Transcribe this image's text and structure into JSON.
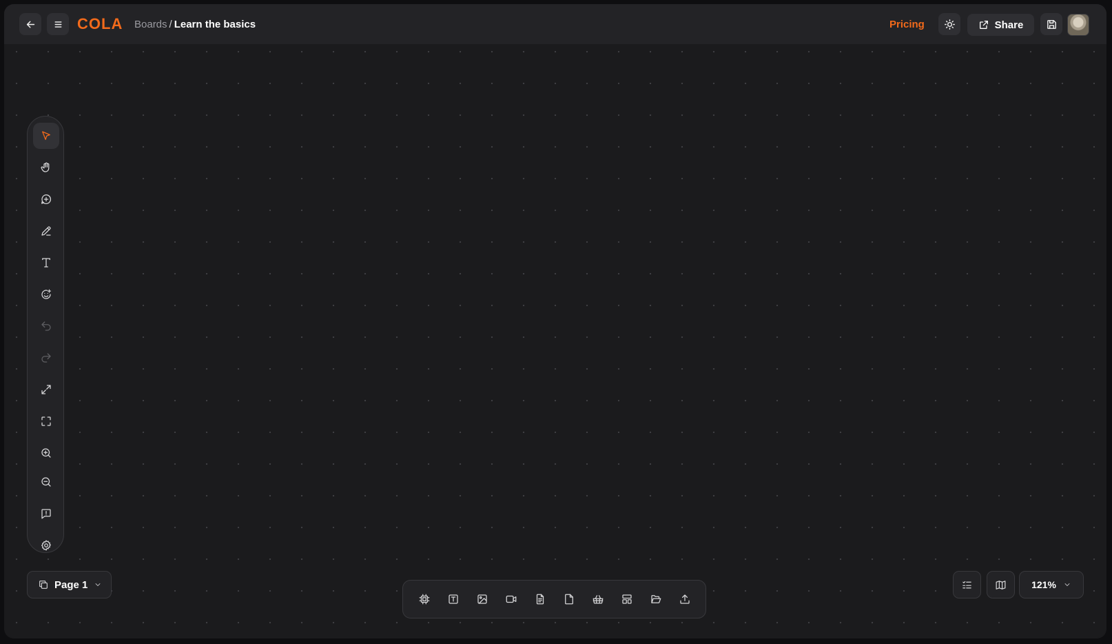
{
  "header": {
    "logo": "COLA",
    "breadcrumb_parent": "Boards",
    "breadcrumb_separator": "/",
    "breadcrumb_current": "Learn the basics",
    "pricing_label": "Pricing",
    "share_label": "Share"
  },
  "left_toolbar": {
    "tools": [
      {
        "name": "select-tool",
        "icon": "cursor-icon",
        "state": "active"
      },
      {
        "name": "hand-tool",
        "icon": "hand-icon",
        "state": "normal"
      },
      {
        "name": "add-tool",
        "icon": "plus-circle-icon",
        "state": "normal"
      },
      {
        "name": "pen-tool",
        "icon": "pencil-icon",
        "state": "normal"
      },
      {
        "name": "text-tool",
        "icon": "text-icon",
        "state": "normal"
      },
      {
        "name": "sticker-tool",
        "icon": "smiley-plus-icon",
        "state": "normal"
      },
      {
        "name": "undo-button",
        "icon": "undo-icon",
        "state": "disabled"
      },
      {
        "name": "redo-button",
        "icon": "redo-icon",
        "state": "disabled"
      },
      {
        "name": "expand-button",
        "icon": "expand-icon",
        "state": "normal"
      },
      {
        "name": "fit-screen-button",
        "icon": "focus-frame-icon",
        "state": "normal"
      },
      {
        "name": "zoom-in-button",
        "icon": "zoom-in-icon",
        "state": "normal"
      },
      {
        "name": "zoom-out-button",
        "icon": "zoom-out-icon",
        "state": "normal"
      },
      {
        "name": "feedback-button",
        "icon": "message-alert-icon",
        "state": "normal"
      },
      {
        "name": "settings-button",
        "icon": "gear-icon",
        "state": "normal"
      }
    ]
  },
  "page_selector": {
    "label": "Page 1"
  },
  "bottom_toolbar": {
    "items": [
      {
        "name": "frame-tool",
        "icon": "frame-icon"
      },
      {
        "name": "text-box-tool",
        "icon": "text-box-icon"
      },
      {
        "name": "image-tool",
        "icon": "image-icon"
      },
      {
        "name": "video-tool",
        "icon": "video-icon"
      },
      {
        "name": "document-tool",
        "icon": "document-icon"
      },
      {
        "name": "note-tool",
        "icon": "note-icon"
      },
      {
        "name": "embed-tool",
        "icon": "basket-icon"
      },
      {
        "name": "layout-tool",
        "icon": "layout-icon"
      },
      {
        "name": "open-folder-tool",
        "icon": "folder-open-icon"
      },
      {
        "name": "upload-tool",
        "icon": "upload-icon"
      }
    ]
  },
  "bottom_right": {
    "zoom_label": "121%"
  },
  "colors": {
    "accent": "#f26a1b",
    "canvas_bg": "#1b1b1d",
    "panel_bg": "#232326"
  }
}
